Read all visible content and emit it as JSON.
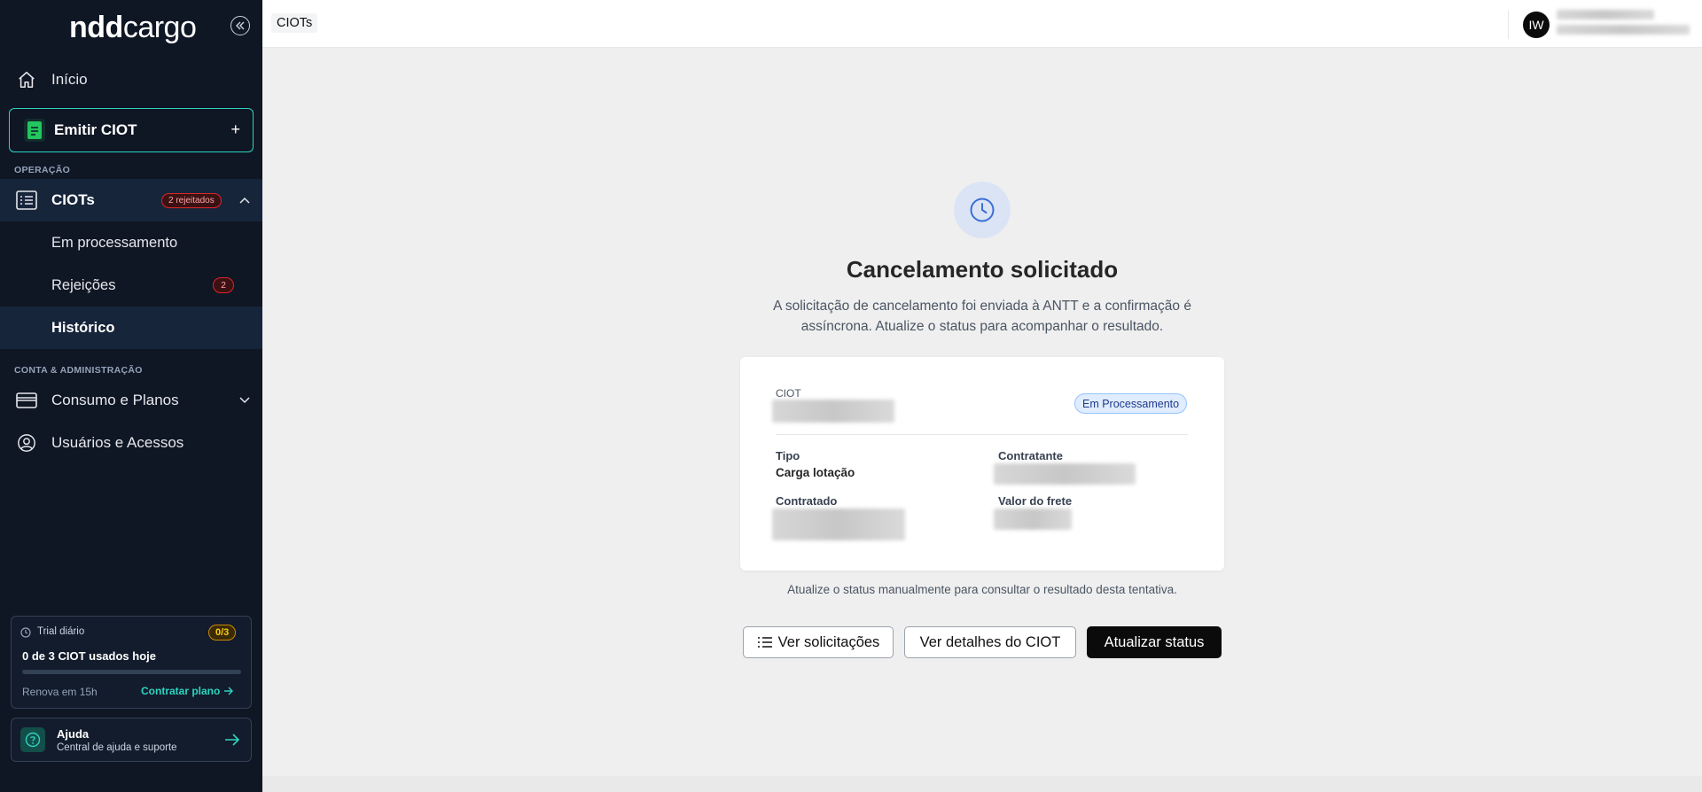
{
  "sidebar": {
    "logo_prefix": "ndd",
    "logo_suffix": "cargo",
    "home_label": "Início",
    "emit_label": "Emitir CIOT",
    "emit_plus": "+",
    "section_operation": "OPERAÇÃO",
    "ciots_label": "CIOTs",
    "ciots_badge": "2 rejeitados",
    "sub_items": [
      {
        "label": "Em processamento"
      },
      {
        "label": "Rejeições",
        "count": "2"
      },
      {
        "label": "Histórico"
      }
    ],
    "section_account": "CONTA & ADMINISTRAÇÃO",
    "plans_label": "Consumo e Planos",
    "users_label": "Usuários e Acessos",
    "trial": {
      "title": "Trial diário",
      "badge": "0/3",
      "usage": "0 de 3 CIOT usados hoje",
      "progress": 0,
      "renew": "Renova em 15h",
      "cta": "Contratar plano"
    },
    "help": {
      "title": "Ajuda",
      "subtitle": "Central de ajuda e suporte"
    }
  },
  "header": {
    "breadcrumb": "CIOTs",
    "avatar_initials": "IW"
  },
  "main": {
    "title": "Cancelamento solicitado",
    "description": "A solicitação de cancelamento foi enviada à ANTT e a confirmação é assíncrona. Atualize o status para acompanhar o resultado.",
    "card": {
      "ciot_label": "CIOT",
      "status": "Em Processamento",
      "tipo_label": "Tipo",
      "tipo_value": "Carga lotação",
      "contratante_label": "Contratante",
      "contratado_label": "Contratado",
      "valor_label": "Valor do frete"
    },
    "note": "Atualize o status manualmente para consultar o resultado desta tentativa.",
    "buttons": {
      "requests": "Ver solicitações",
      "details": "Ver detalhes do CIOT",
      "refresh": "Atualizar status"
    }
  },
  "colors": {
    "sidebar_bg": "#0f1624",
    "accent_teal": "#2dd4bf",
    "danger": "#dc2626",
    "primary_dark": "#0b0b0b"
  }
}
